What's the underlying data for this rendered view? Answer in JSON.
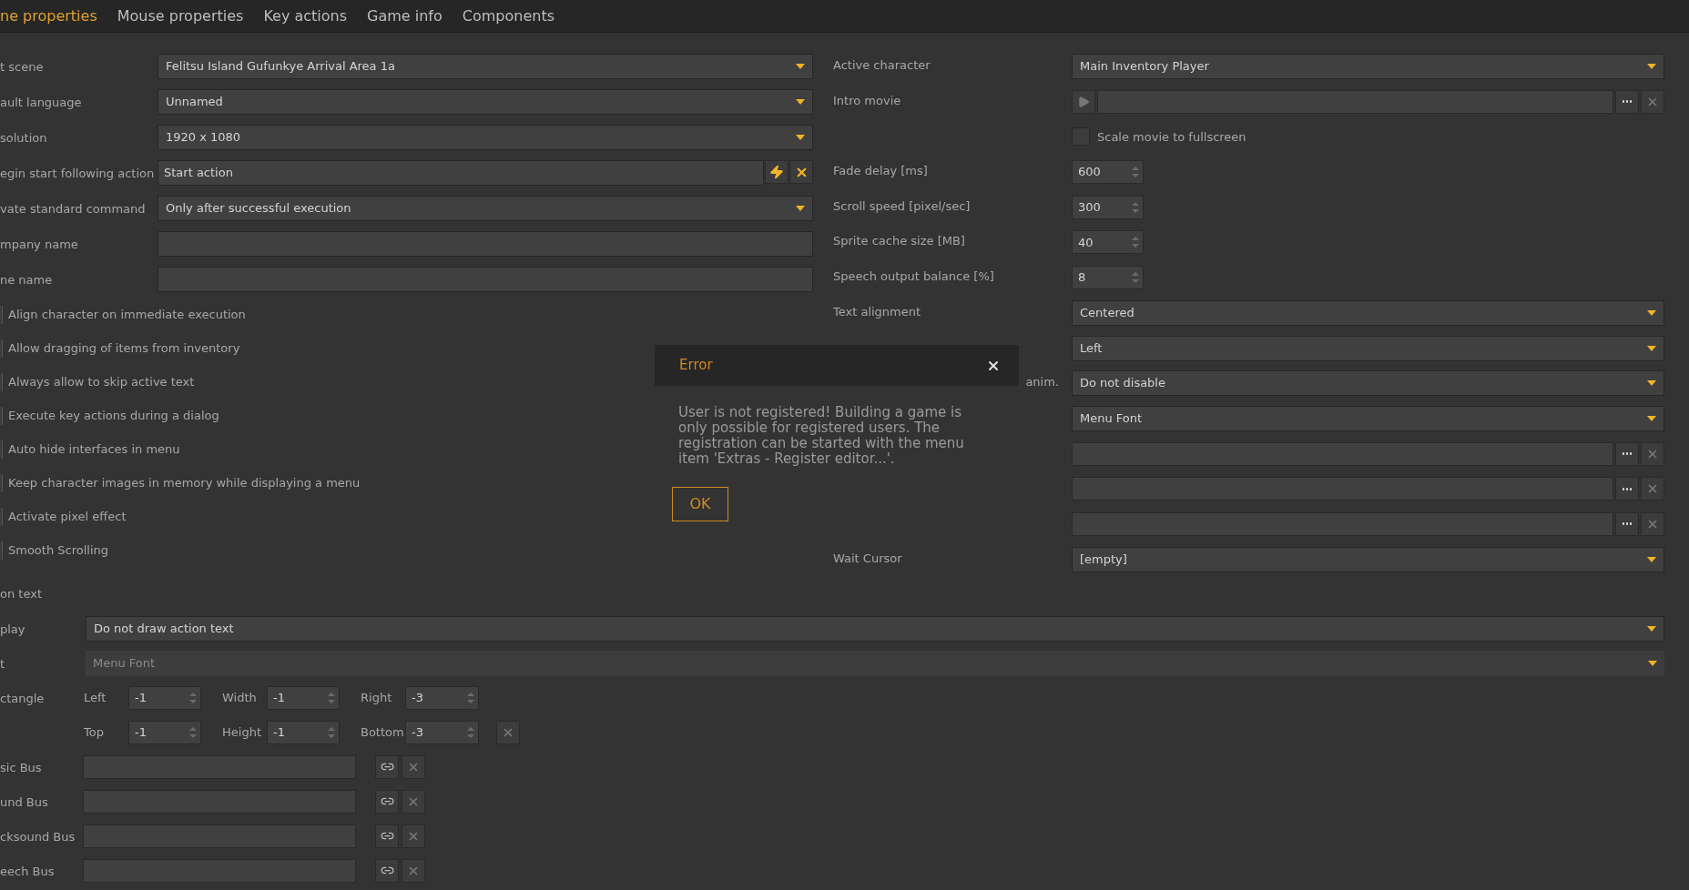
{
  "tabs": [
    {
      "label": "ne properties",
      "selected": true
    },
    {
      "label": "Mouse properties",
      "selected": false
    },
    {
      "label": "Key actions",
      "selected": false
    },
    {
      "label": "Game info",
      "selected": false
    },
    {
      "label": "Components",
      "selected": false
    }
  ],
  "left_fields": [
    {
      "kind": "dropdown",
      "label": "t scene",
      "value": "Felitsu Island Gufunkye Arrival Area 1a"
    },
    {
      "kind": "dropdown",
      "label": "ault language",
      "value": "Unnamed"
    },
    {
      "kind": "dropdown",
      "label": "solution",
      "value": "1920 x 1080"
    },
    {
      "kind": "action",
      "label": "egin start following action",
      "value": "Start action"
    },
    {
      "kind": "dropdown",
      "label": "vate standard command",
      "value": "Only after successful execution"
    },
    {
      "kind": "text",
      "label": "mpany name"
    },
    {
      "kind": "text",
      "label": "ne name"
    }
  ],
  "options": [
    {
      "label": "Align character on immediate execution",
      "checked": false
    },
    {
      "label": "Allow dragging of items from inventory",
      "checked": false
    },
    {
      "label": "Always allow to skip active text",
      "checked": false
    },
    {
      "label": "Execute key actions during a dialog",
      "checked": false
    },
    {
      "label": "Auto hide interfaces in menu",
      "checked": false
    },
    {
      "label": "Keep character images in memory while displaying a menu",
      "checked": false
    },
    {
      "label": "Activate pixel effect",
      "checked": false
    },
    {
      "label": "Smooth Scrolling",
      "checked": false
    }
  ],
  "right_fields": [
    {
      "kind": "dropdown",
      "label": "Active character",
      "value": "Main Inventory Player"
    },
    {
      "kind": "movie",
      "label": "Intro movie"
    },
    {
      "kind": "checkbox",
      "text": "Scale movie to fullscreen",
      "checked": false
    },
    {
      "kind": "spin",
      "label": "Fade delay [ms]",
      "value": "600"
    },
    {
      "kind": "spin",
      "label": "Scroll speed [pixel/sec]",
      "value": "300"
    },
    {
      "kind": "spin",
      "label": "Sprite cache size [MB]",
      "value": "40"
    },
    {
      "kind": "spin",
      "label": "Speech output balance [%]",
      "value": "8"
    },
    {
      "kind": "dropdown",
      "label": "Text alignment",
      "value": "Centered"
    },
    {
      "kind": "dropdown",
      "value": "Left"
    },
    {
      "kind": "dropdown",
      "label": "anim.",
      "label_cut_at_start": true,
      "value": "Do not disable"
    },
    {
      "kind": "dropdown",
      "value": "Menu Font"
    },
    {
      "kind": "file"
    },
    {
      "kind": "file"
    },
    {
      "kind": "file"
    },
    {
      "kind": "dropdown",
      "label": "Wait Cursor",
      "value": "[empty]"
    }
  ],
  "action_text": {
    "title": "on text",
    "display": {
      "label": "play",
      "value": "Do not draw action text",
      "disabled": false
    },
    "font": {
      "label": "t",
      "value": "Menu Font",
      "disabled": true
    },
    "rectangle": {
      "label": "ctangle",
      "rows": [
        [
          {
            "label": "Left",
            "value": "-1"
          },
          {
            "label": "Width",
            "value": "-1"
          },
          {
            "label": "Right",
            "value": "-3"
          }
        ],
        [
          {
            "label": "Top",
            "value": "-1"
          },
          {
            "label": "Height",
            "value": "-1"
          },
          {
            "label": "Bottom",
            "value": "-3"
          }
        ]
      ]
    }
  },
  "buses": [
    {
      "label": "sic Bus"
    },
    {
      "label": "und Bus"
    },
    {
      "label": "cksound Bus"
    },
    {
      "label": "eech Bus"
    }
  ],
  "dialog": {
    "title": "Error",
    "message": "User is not registered! Building a game is only possible for registered users. The registration can be started with the menu item 'Extras - Register editor...'.",
    "button": "OK"
  }
}
